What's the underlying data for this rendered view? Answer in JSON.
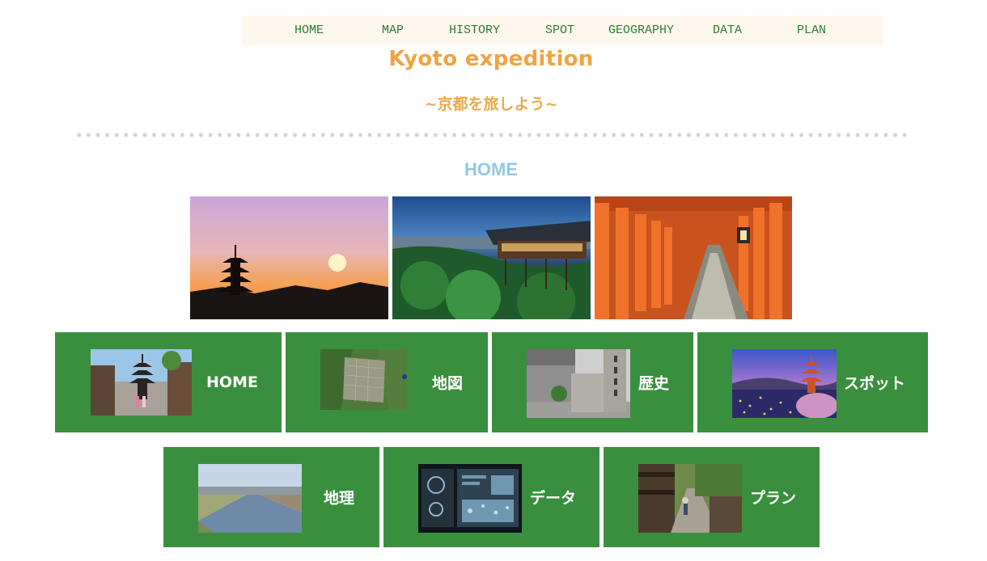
{
  "nav": {
    "items": [
      {
        "label": "HOME"
      },
      {
        "label": "MAP"
      },
      {
        "label": "HISTORY"
      },
      {
        "label": "SPOT"
      },
      {
        "label": "GEOGRAPHY"
      },
      {
        "label": "DATA"
      },
      {
        "label": "PLAN"
      }
    ]
  },
  "header": {
    "title": "Kyoto expedition",
    "subtitle": "~京都を旅しよう~"
  },
  "section": {
    "heading": "HOME"
  },
  "cards": [
    {
      "label": "HOME"
    },
    {
      "label": "地図"
    },
    {
      "label": "歴史"
    },
    {
      "label": "スポット"
    },
    {
      "label": "地理"
    },
    {
      "label": "データ"
    },
    {
      "label": "プラン"
    }
  ],
  "colors": {
    "nav_bg": "#fdf7ee",
    "nav_text": "#2e7d32",
    "title": "#f0a340",
    "heading": "#92c8e3",
    "card_bg": "#3a8f3f"
  }
}
